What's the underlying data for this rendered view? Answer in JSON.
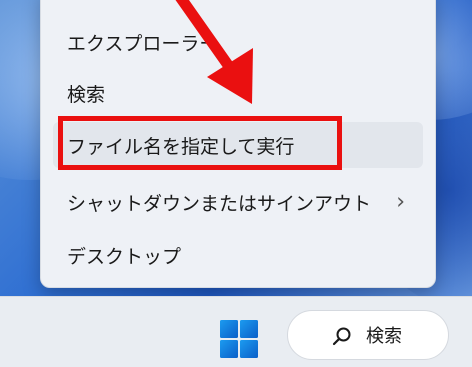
{
  "menu": {
    "items": [
      {
        "label": "エクスプローラー"
      },
      {
        "label": "検索"
      },
      {
        "label": "ファイル名を指定して実行"
      },
      {
        "label": "シャットダウンまたはサインアウト",
        "chevron": "›"
      },
      {
        "label": "デスクトップ"
      }
    ]
  },
  "taskbar": {
    "search_label": "検索",
    "start_icon": "windows-logo-icon",
    "search_icon": "search-icon"
  },
  "annotation": {
    "color": "#ea1010"
  },
  "colors": {
    "menu_bg": "#eef1f6",
    "accent_blue": "#0f6cbd",
    "taskbar_bg": "#e9edf2"
  }
}
